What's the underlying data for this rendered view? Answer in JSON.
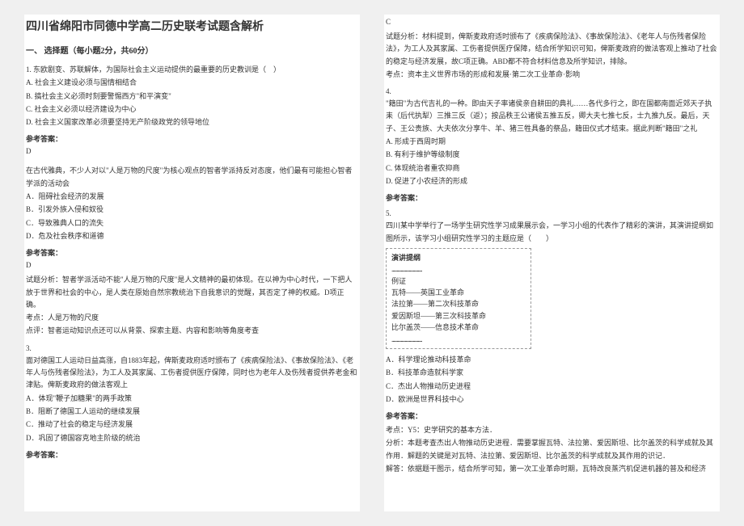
{
  "title": "四川省绵阳市同德中学高二历史联考试题含解析",
  "sectionHeader": "一、 选择题（每小题2分，共60分）",
  "left": {
    "q1": {
      "stem": "1. 东欧剧变、苏联解体，为国际社会主义运动提供的最重要的历史教训是（　）",
      "a": "A. 社会主义建设必须与国情相结合",
      "b": "B. 搞社会主义必须时刻要警惕西方\"和平演变\"",
      "c": "C. 社会主义必须以经济建设为中心",
      "d": "D. 社会主义国家改革必须要坚持无产阶级政党的领导地位",
      "refLabel": "参考答案：",
      "ans": "D"
    },
    "q2": {
      "stem": "在古代雅典，不少人对以\"人是万物的尺度\"为核心观点的智者学派持反对态度，他们最有可能担心智者学派的活动会",
      "a": "A．阻碍社会经济的发展",
      "b": "B．引发外族入侵和奴役",
      "c": "C．导致雅典人口的流失",
      "d": "D．危及社会秩序和道德",
      "refLabel": "参考答案：",
      "ans": "D",
      "analysis1": "试题分析：智者学派活动不能\"人是万物的尺度\"是人文精神的最初体现。在以神为中心时代，一下把人放于世界和社会的中心，是人类在原始自然宗教统治下自我意识的觉醒，其否定了神的权威。D项正确。",
      "kaodian": "考点：人是万物的尺度",
      "dianping": "点评：智者运动知识点还可以从背景、探索主题、内容和影响等角度考查"
    },
    "q3": {
      "num": "3.",
      "stem": "面对德国工人运动日益高涨，自1883年起，俾斯麦政府适时颁布了《疾病保险法》、《事故保险法》、《老年人与伤残者保险法》，为工人及其家属、工伤者提供医疗保障，同时也为老年人及伤残者提供养老金和津贴。俾斯麦政府的做法客观上",
      "a": "A．体现\"鞭子加糖果\"的两手政策",
      "b": "B．阻断了德国工人运动的继续发展",
      "c": "C．推动了社会的稳定与经济发展",
      "d": "D．巩固了德国容克地主阶级的统治",
      "refLabel": "参考答案："
    }
  },
  "right": {
    "q3cont": {
      "ans": "C",
      "analysis": "试题分析：材料提到，俾斯麦政府适时颁布了《疾病保险法》、《事故保险法》、《老年人与伤残者保险法》，为工人及其家属、工伤者提供医疗保障，结合所学知识可知，俾斯麦政府的做法客观上推动了社会的稳定与经济发展，故C项正确。ABD都不符合材料信息及所学知识，排除。",
      "kaodian": "考点：资本主义世界市场的形成和发展·第二次工业革命·影响"
    },
    "q4": {
      "num": "4.",
      "stem": "\"籍田\"为古代吉礼的一种。即由天子率诸侯亲自耕田的典礼……各代多行之，即在国都南面近郊天子执耒（后代执犁）三推三反（返）；按品秩王公诸侯五推五反，卿大夫七推七反，士九推九反。最后，天子、王公贵族、大夫依次分享牛、羊、猪三牲具备的祭品，籍田仪式才结束。据此判断\"籍田\"之礼",
      "a": "A. 形成于西周时期",
      "b": "B. 有利于维护等级制度",
      "c": "C. 体现统治者重农抑商",
      "d": "D. 促进了小农经济的形成",
      "refLabel": "参考答案："
    },
    "q5": {
      "num": "5.",
      "stem": "四川某中学举行了一场学生研究性学习成果展示会，一学习小组的代表作了精彩的演讲，其演讲提纲如图所示，该学习小组研究性学习的主题应是（　　）",
      "boxTitle": "演讲提纲",
      "boxSub": "例证",
      "box1": "瓦特——英国工业革命",
      "box2": "法拉第——第二次科技革命",
      "box3": "爱因斯坦——第三次科技革命",
      "box4": "比尔盖茨——信息技术革命",
      "a": "A．科学理论推动科技革命",
      "b": "B．科技革命造就科学家",
      "c": "C．杰出人物推动历史进程",
      "d": "D．欧洲是世界科技中心",
      "refLabel": "参考答案：",
      "kaodian": "考点：Y5：史学研究的基本方法．",
      "analysis": "分析：本题考查杰出人物推动历史进程．需要掌握瓦特、法拉第、爱因斯坦、比尔盖茨的科学成就及其作用．解题的关键是对瓦特、法拉第、爱因斯坦、比尔盖茨的科学成就及其作用的识记．",
      "jieda": "解答：依据题干图示，结合所学可知，第一次工业革命时期，瓦特改良蒸汽机促进机器的普及和经济"
    }
  }
}
